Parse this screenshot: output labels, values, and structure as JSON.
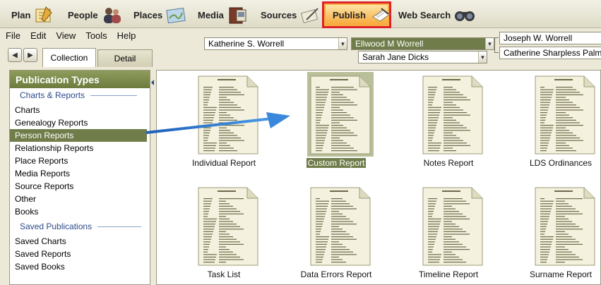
{
  "toolbar": {
    "items": [
      {
        "label": "Plan",
        "icon": "plan-icon"
      },
      {
        "label": "People",
        "icon": "people-icon"
      },
      {
        "label": "Places",
        "icon": "places-icon"
      },
      {
        "label": "Media",
        "icon": "media-icon"
      },
      {
        "label": "Sources",
        "icon": "sources-icon"
      },
      {
        "label": "Publish",
        "icon": "publish-icon"
      },
      {
        "label": "Web Search",
        "icon": "web-search-icon"
      }
    ],
    "highlight_color": "#e0202a"
  },
  "menu": [
    "File",
    "Edit",
    "View",
    "Tools",
    "Help"
  ],
  "tabs": {
    "collection": "Collection",
    "detail": "Detail"
  },
  "family": {
    "father_of_focus": "Katherine S. Worrell",
    "focus": "Ellwood M Worrell",
    "spouse": "Sarah Jane Dicks",
    "paternal_grandfather": "Joseph W. Worrell",
    "paternal_grandmother": "Catherine Sharpless Palmer"
  },
  "left_panel": {
    "title": "Publication Types",
    "section1": "Charts & Reports",
    "items1": [
      "Charts",
      "Genealogy Reports",
      "Person Reports",
      "Relationship Reports",
      "Place Reports",
      "Media Reports",
      "Source Reports",
      "Other",
      "Books"
    ],
    "section2": "Saved Publications",
    "items2": [
      "Saved Charts",
      "Saved Reports",
      "Saved Books"
    ],
    "selected": "Person Reports"
  },
  "reports": [
    {
      "label": "Individual Report"
    },
    {
      "label": "Custom Report"
    },
    {
      "label": "Notes Report"
    },
    {
      "label": "LDS Ordinances"
    },
    {
      "label": "Task List"
    },
    {
      "label": "Data Errors Report"
    },
    {
      "label": "Timeline Report"
    },
    {
      "label": "Surname Report"
    }
  ],
  "colors": {
    "accent": "#707d4a",
    "arrow": "#2f7fd6",
    "section_text": "#2b4a8a"
  }
}
